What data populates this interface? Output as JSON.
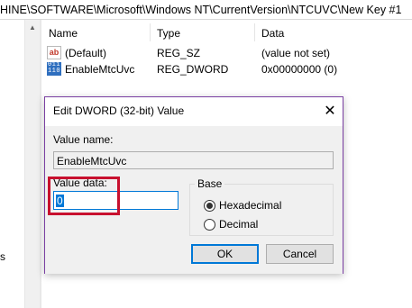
{
  "address_bar": {
    "path": "HINE\\SOFTWARE\\Microsoft\\Windows NT\\CurrentVersion\\NTCUVC\\New Key #1"
  },
  "tree": {
    "fragment_text": "s"
  },
  "list": {
    "columns": [
      "Name",
      "Type",
      "Data"
    ],
    "rows": [
      {
        "icon": "string-value-icon",
        "name": "(Default)",
        "type": "REG_SZ",
        "data": "(value not set)"
      },
      {
        "icon": "binary-value-icon",
        "name": "EnableMtcUvc",
        "type": "REG_DWORD",
        "data": "0x00000000 (0)"
      }
    ]
  },
  "dialog": {
    "title": "Edit DWORD (32-bit) Value",
    "close_glyph": "✕",
    "value_name_label": "Value name:",
    "value_name": "EnableMtcUvc",
    "value_data_label": "Value data:",
    "value_data": "0",
    "base_label": "Base",
    "base_options": [
      {
        "label": "Hexadecimal",
        "selected": true
      },
      {
        "label": "Decimal",
        "selected": false
      }
    ],
    "ok_label": "OK",
    "cancel_label": "Cancel"
  },
  "colors": {
    "highlight": "#c8102e",
    "dialog_border": "#7a3fa2",
    "selection": "#0078d7"
  }
}
